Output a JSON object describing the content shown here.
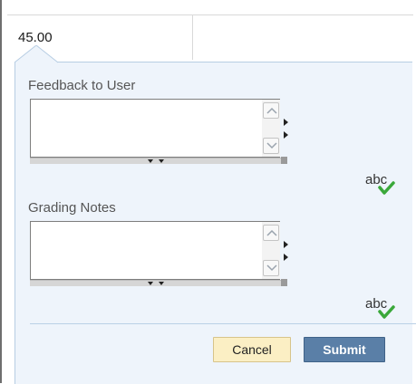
{
  "grade": {
    "value": "45.00"
  },
  "feedback": {
    "label": "Feedback to User",
    "value": ""
  },
  "grading_notes": {
    "label": "Grading Notes",
    "value": ""
  },
  "spellcheck": {
    "text": "abc"
  },
  "actions": {
    "cancel_label": "Cancel",
    "submit_label": "Submit"
  },
  "colors": {
    "panel_bg": "#eef4fb",
    "submit_bg": "#5a7fa7",
    "cancel_bg": "#fbefc4",
    "check_green": "#3aa83a"
  }
}
